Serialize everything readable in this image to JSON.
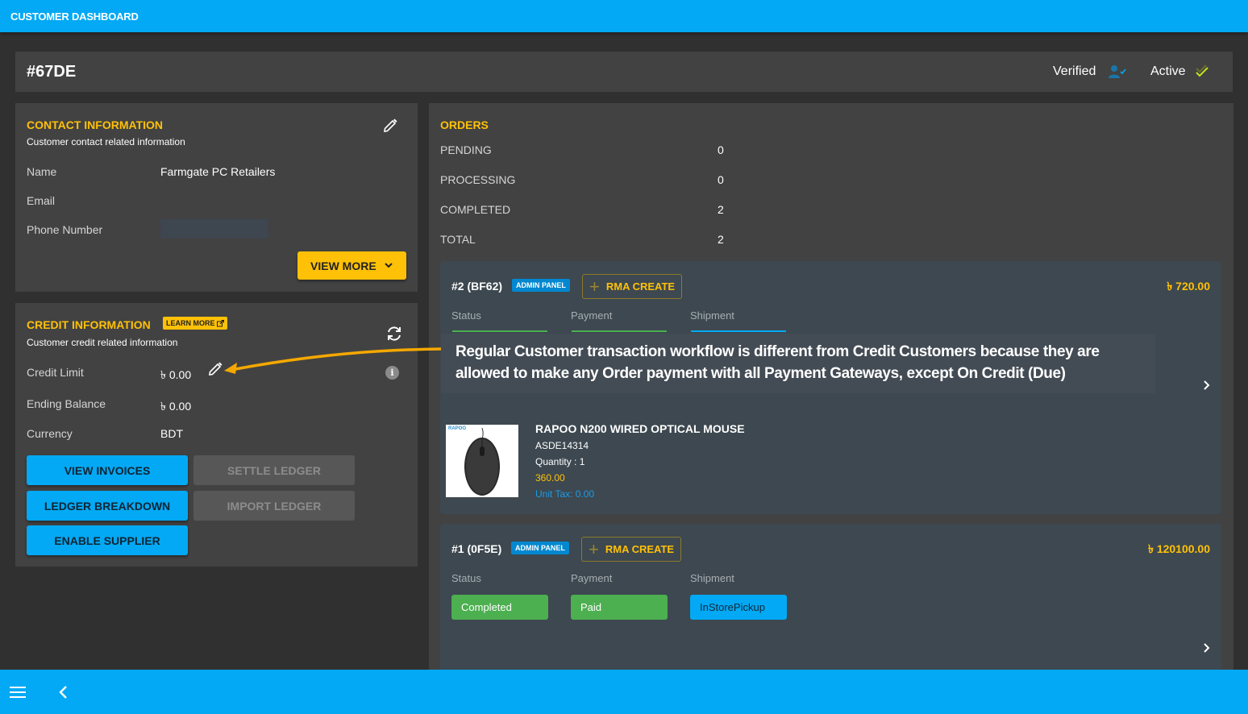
{
  "app": {
    "title": "CUSTOMER DASHBOARD"
  },
  "customer": {
    "id": "#67DE",
    "verified_label": "Verified",
    "active_label": "Active"
  },
  "contact": {
    "title": "CONTACT INFORMATION",
    "subtitle": "Customer contact related information",
    "fields": [
      {
        "label": "Name",
        "value": "Farmgate PC Retailers"
      },
      {
        "label": "Email",
        "value": ""
      },
      {
        "label": "Phone Number",
        "value": ""
      }
    ],
    "view_more_label": "VIEW MORE"
  },
  "credit": {
    "title": "CREDIT INFORMATION",
    "learn_more_label": "LEARN MORE",
    "subtitle": "Customer credit related information",
    "currency_symbol": "৳",
    "fields": [
      {
        "label": "Credit Limit",
        "value": "0.00"
      },
      {
        "label": "Ending Balance",
        "value": "0.00"
      },
      {
        "label": "Currency",
        "value": "BDT"
      }
    ],
    "buttons": {
      "view_invoices": "VIEW INVOICES",
      "settle_ledger": "SETTLE LEDGER",
      "ledger_breakdown": "LEDGER BREAKDOWN",
      "import_ledger": "IMPORT LEDGER",
      "enable_supplier": "ENABLE SUPPLIER"
    }
  },
  "orders": {
    "title": "ORDERS",
    "summary": [
      {
        "label": "PENDING",
        "value": "0"
      },
      {
        "label": "PROCESSING",
        "value": "0"
      },
      {
        "label": "COMPLETED",
        "value": "2"
      },
      {
        "label": "TOTAL",
        "value": "2"
      }
    ],
    "field_labels": {
      "status": "Status",
      "payment": "Payment",
      "shipment": "Shipment"
    },
    "admin_badge": "ADMIN PANEL",
    "rma_label": "RMA CREATE",
    "list": [
      {
        "id": "#2 (BF62)",
        "amount": "৳  720.00",
        "item": {
          "brand": "RAPOO",
          "name": "RAPOO N200 WIRED OPTICAL MOUSE",
          "sku": "ASDE14314",
          "quantity": "Quantity : 1",
          "price": "360.00",
          "unit_tax": "Unit Tax: 0.00"
        }
      },
      {
        "id": "#1 (0F5E)",
        "amount": "৳  120100.00",
        "status": "Completed",
        "payment": "Paid",
        "shipment": "InStorePickup"
      }
    ]
  },
  "annotation": {
    "text": "Regular Customer transaction workflow is different from Credit Customers because they are allowed to make any Order payment with all Payment Gateways, except On Credit (Due)"
  },
  "colors": {
    "primary": "#03a9f4",
    "accent": "#ffc107",
    "success": "#4caf50",
    "card": "#424242",
    "order_card": "#3d4850",
    "background": "#303030"
  }
}
